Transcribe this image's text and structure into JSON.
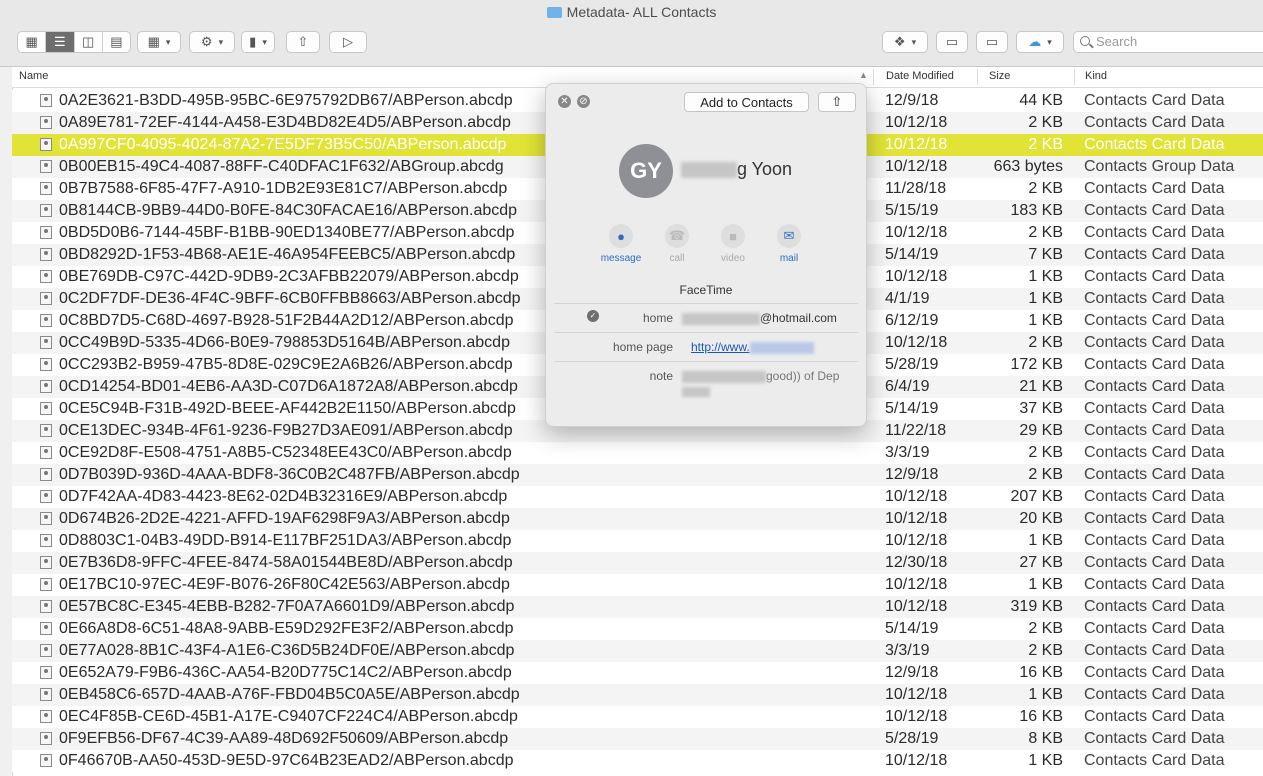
{
  "window": {
    "title": "Metadata- ALL Contacts"
  },
  "toolbar": {
    "view_icons": [
      "icon-view-icon",
      "list-view-icon",
      "column-view-icon",
      "gallery-view-icon"
    ],
    "search_placeholder": "Search"
  },
  "columns": {
    "name": "Name",
    "date": "Date Modified",
    "size": "Size",
    "kind": "Kind"
  },
  "rows": [
    {
      "name": "0A2E3621-B3DD-495B-95BC-6E975792DB67/ABPerson.abcdp",
      "date": "12/9/18",
      "size": "44 KB",
      "kind": "Contacts Card Data"
    },
    {
      "name": "0A89E781-72EF-4144-A458-E3D4BD82E4D5/ABPerson.abcdp",
      "date": "10/12/18",
      "size": "2 KB",
      "kind": "Contacts Card Data"
    },
    {
      "name": "0A997CF0-4095-4024-87A2-7E5DF73B5C50/ABPerson.abcdp",
      "date": "10/12/18",
      "size": "2 KB",
      "kind": "Contacts Card Data",
      "selected": true
    },
    {
      "name": "0B00EB15-49C4-4087-88FF-C40DFAC1F632/ABGroup.abcdg",
      "date": "10/12/18",
      "size": "663 bytes",
      "kind": "Contacts Group Data"
    },
    {
      "name": "0B7B7588-6F85-47F7-A910-1DB2E93E81C7/ABPerson.abcdp",
      "date": "11/28/18",
      "size": "2 KB",
      "kind": "Contacts Card Data"
    },
    {
      "name": "0B8144CB-9BB9-44D0-B0FE-84C30FACAE16/ABPerson.abcdp",
      "date": "5/15/19",
      "size": "183 KB",
      "kind": "Contacts Card Data"
    },
    {
      "name": "0BD5D0B6-7144-45BF-B1BB-90ED1340BE77/ABPerson.abcdp",
      "date": "10/12/18",
      "size": "2 KB",
      "kind": "Contacts Card Data"
    },
    {
      "name": "0BD8292D-1F53-4B68-AE1E-46A954FEEBC5/ABPerson.abcdp",
      "date": "5/14/19",
      "size": "7 KB",
      "kind": "Contacts Card Data"
    },
    {
      "name": "0BE769DB-C97C-442D-9DB9-2C3AFBB22079/ABPerson.abcdp",
      "date": "10/12/18",
      "size": "1 KB",
      "kind": "Contacts Card Data"
    },
    {
      "name": "0C2DF7DF-DE36-4F4C-9BFF-6CB0FFBB8663/ABPerson.abcdp",
      "date": "4/1/19",
      "size": "1 KB",
      "kind": "Contacts Card Data"
    },
    {
      "name": "0C8BD7D5-C68D-4697-B928-51F2B44A2D12/ABPerson.abcdp",
      "date": "6/12/19",
      "size": "1 KB",
      "kind": "Contacts Card Data"
    },
    {
      "name": "0CC49B9D-5335-4D66-B0E9-798853D5164B/ABPerson.abcdp",
      "date": "10/12/18",
      "size": "2 KB",
      "kind": "Contacts Card Data"
    },
    {
      "name": "0CC293B2-B959-47B5-8D8E-029C9E2A6B26/ABPerson.abcdp",
      "date": "5/28/19",
      "size": "172 KB",
      "kind": "Contacts Card Data"
    },
    {
      "name": "0CD14254-BD01-4EB6-AA3D-C07D6A1872A8/ABPerson.abcdp",
      "date": "6/4/19",
      "size": "21 KB",
      "kind": "Contacts Card Data"
    },
    {
      "name": "0CE5C94B-F31B-492D-BEEE-AF442B2E1150/ABPerson.abcdp",
      "date": "5/14/19",
      "size": "37 KB",
      "kind": "Contacts Card Data"
    },
    {
      "name": "0CE13DEC-934B-4F61-9236-F9B27D3AE091/ABPerson.abcdp",
      "date": "11/22/18",
      "size": "29 KB",
      "kind": "Contacts Card Data"
    },
    {
      "name": "0CE92D8F-E508-4751-A8B5-C52348EE43C0/ABPerson.abcdp",
      "date": "3/3/19",
      "size": "2 KB",
      "kind": "Contacts Card Data"
    },
    {
      "name": "0D7B039D-936D-4AAA-BDF8-36C0B2C487FB/ABPerson.abcdp",
      "date": "12/9/18",
      "size": "2 KB",
      "kind": "Contacts Card Data"
    },
    {
      "name": "0D7F42AA-4D83-4423-8E62-02D4B32316E9/ABPerson.abcdp",
      "date": "10/12/18",
      "size": "207 KB",
      "kind": "Contacts Card Data"
    },
    {
      "name": "0D674B26-2D2E-4221-AFFD-19AF6298F9A3/ABPerson.abcdp",
      "date": "10/12/18",
      "size": "20 KB",
      "kind": "Contacts Card Data"
    },
    {
      "name": "0D8803C1-04B3-49DD-B914-E117BF251DA3/ABPerson.abcdp",
      "date": "10/12/18",
      "size": "1 KB",
      "kind": "Contacts Card Data"
    },
    {
      "name": "0E7B36D8-9FFC-4FEE-8474-58A01544BE8D/ABPerson.abcdp",
      "date": "12/30/18",
      "size": "27 KB",
      "kind": "Contacts Card Data"
    },
    {
      "name": "0E17BC10-97EC-4E9F-B076-26F80C42E563/ABPerson.abcdp",
      "date": "10/12/18",
      "size": "1 KB",
      "kind": "Contacts Card Data"
    },
    {
      "name": "0E57BC8C-E345-4EBB-B282-7F0A7A6601D9/ABPerson.abcdp",
      "date": "10/12/18",
      "size": "319 KB",
      "kind": "Contacts Card Data"
    },
    {
      "name": "0E66A8D8-6C51-48A8-9ABB-E59D292FE3F2/ABPerson.abcdp",
      "date": "5/14/19",
      "size": "2 KB",
      "kind": "Contacts Card Data"
    },
    {
      "name": "0E77A028-8B1C-43F4-A1E6-C36D5B24DF0E/ABPerson.abcdp",
      "date": "3/3/19",
      "size": "2 KB",
      "kind": "Contacts Card Data"
    },
    {
      "name": "0E652A79-F9B6-436C-AA54-B20D775C14C2/ABPerson.abcdp",
      "date": "12/9/18",
      "size": "16 KB",
      "kind": "Contacts Card Data"
    },
    {
      "name": "0EB458C6-657D-4AAB-A76F-FBD04B5C0A5E/ABPerson.abcdp",
      "date": "10/12/18",
      "size": "1 KB",
      "kind": "Contacts Card Data"
    },
    {
      "name": "0EC4F85B-CE6D-45B1-A17E-C9407CF224C4/ABPerson.abcdp",
      "date": "10/12/18",
      "size": "16 KB",
      "kind": "Contacts Card Data"
    },
    {
      "name": "0F9EFB56-DF67-4C39-AA89-48D692F50609/ABPerson.abcdp",
      "date": "5/28/19",
      "size": "8 KB",
      "kind": "Contacts Card Data"
    },
    {
      "name": "0F46670B-AA50-453D-9E5D-97C64B23EAD2/ABPerson.abcdp",
      "date": "10/12/18",
      "size": "1 KB",
      "kind": "Contacts Card Data"
    }
  ],
  "popup": {
    "add_button": "Add to Contacts",
    "initials": "GY",
    "name_visible": "g Yoon",
    "actions": [
      {
        "label": "message",
        "glyph": "●",
        "enabled": true
      },
      {
        "label": "call",
        "glyph": "☎",
        "enabled": false
      },
      {
        "label": "video",
        "glyph": "■",
        "enabled": false
      },
      {
        "label": "mail",
        "glyph": "✉",
        "enabled": true
      }
    ],
    "section": "FaceTime",
    "fields": {
      "home_label": "home",
      "home_value": "@hotmail.com",
      "homepage_label": "home page",
      "homepage_value": "http://www.",
      "note_label": "note",
      "note_value": "good)) of Dep"
    }
  },
  "colors": {
    "selection": "#e1e337",
    "link": "#1a56b8",
    "accent": "#2a6dc2"
  }
}
